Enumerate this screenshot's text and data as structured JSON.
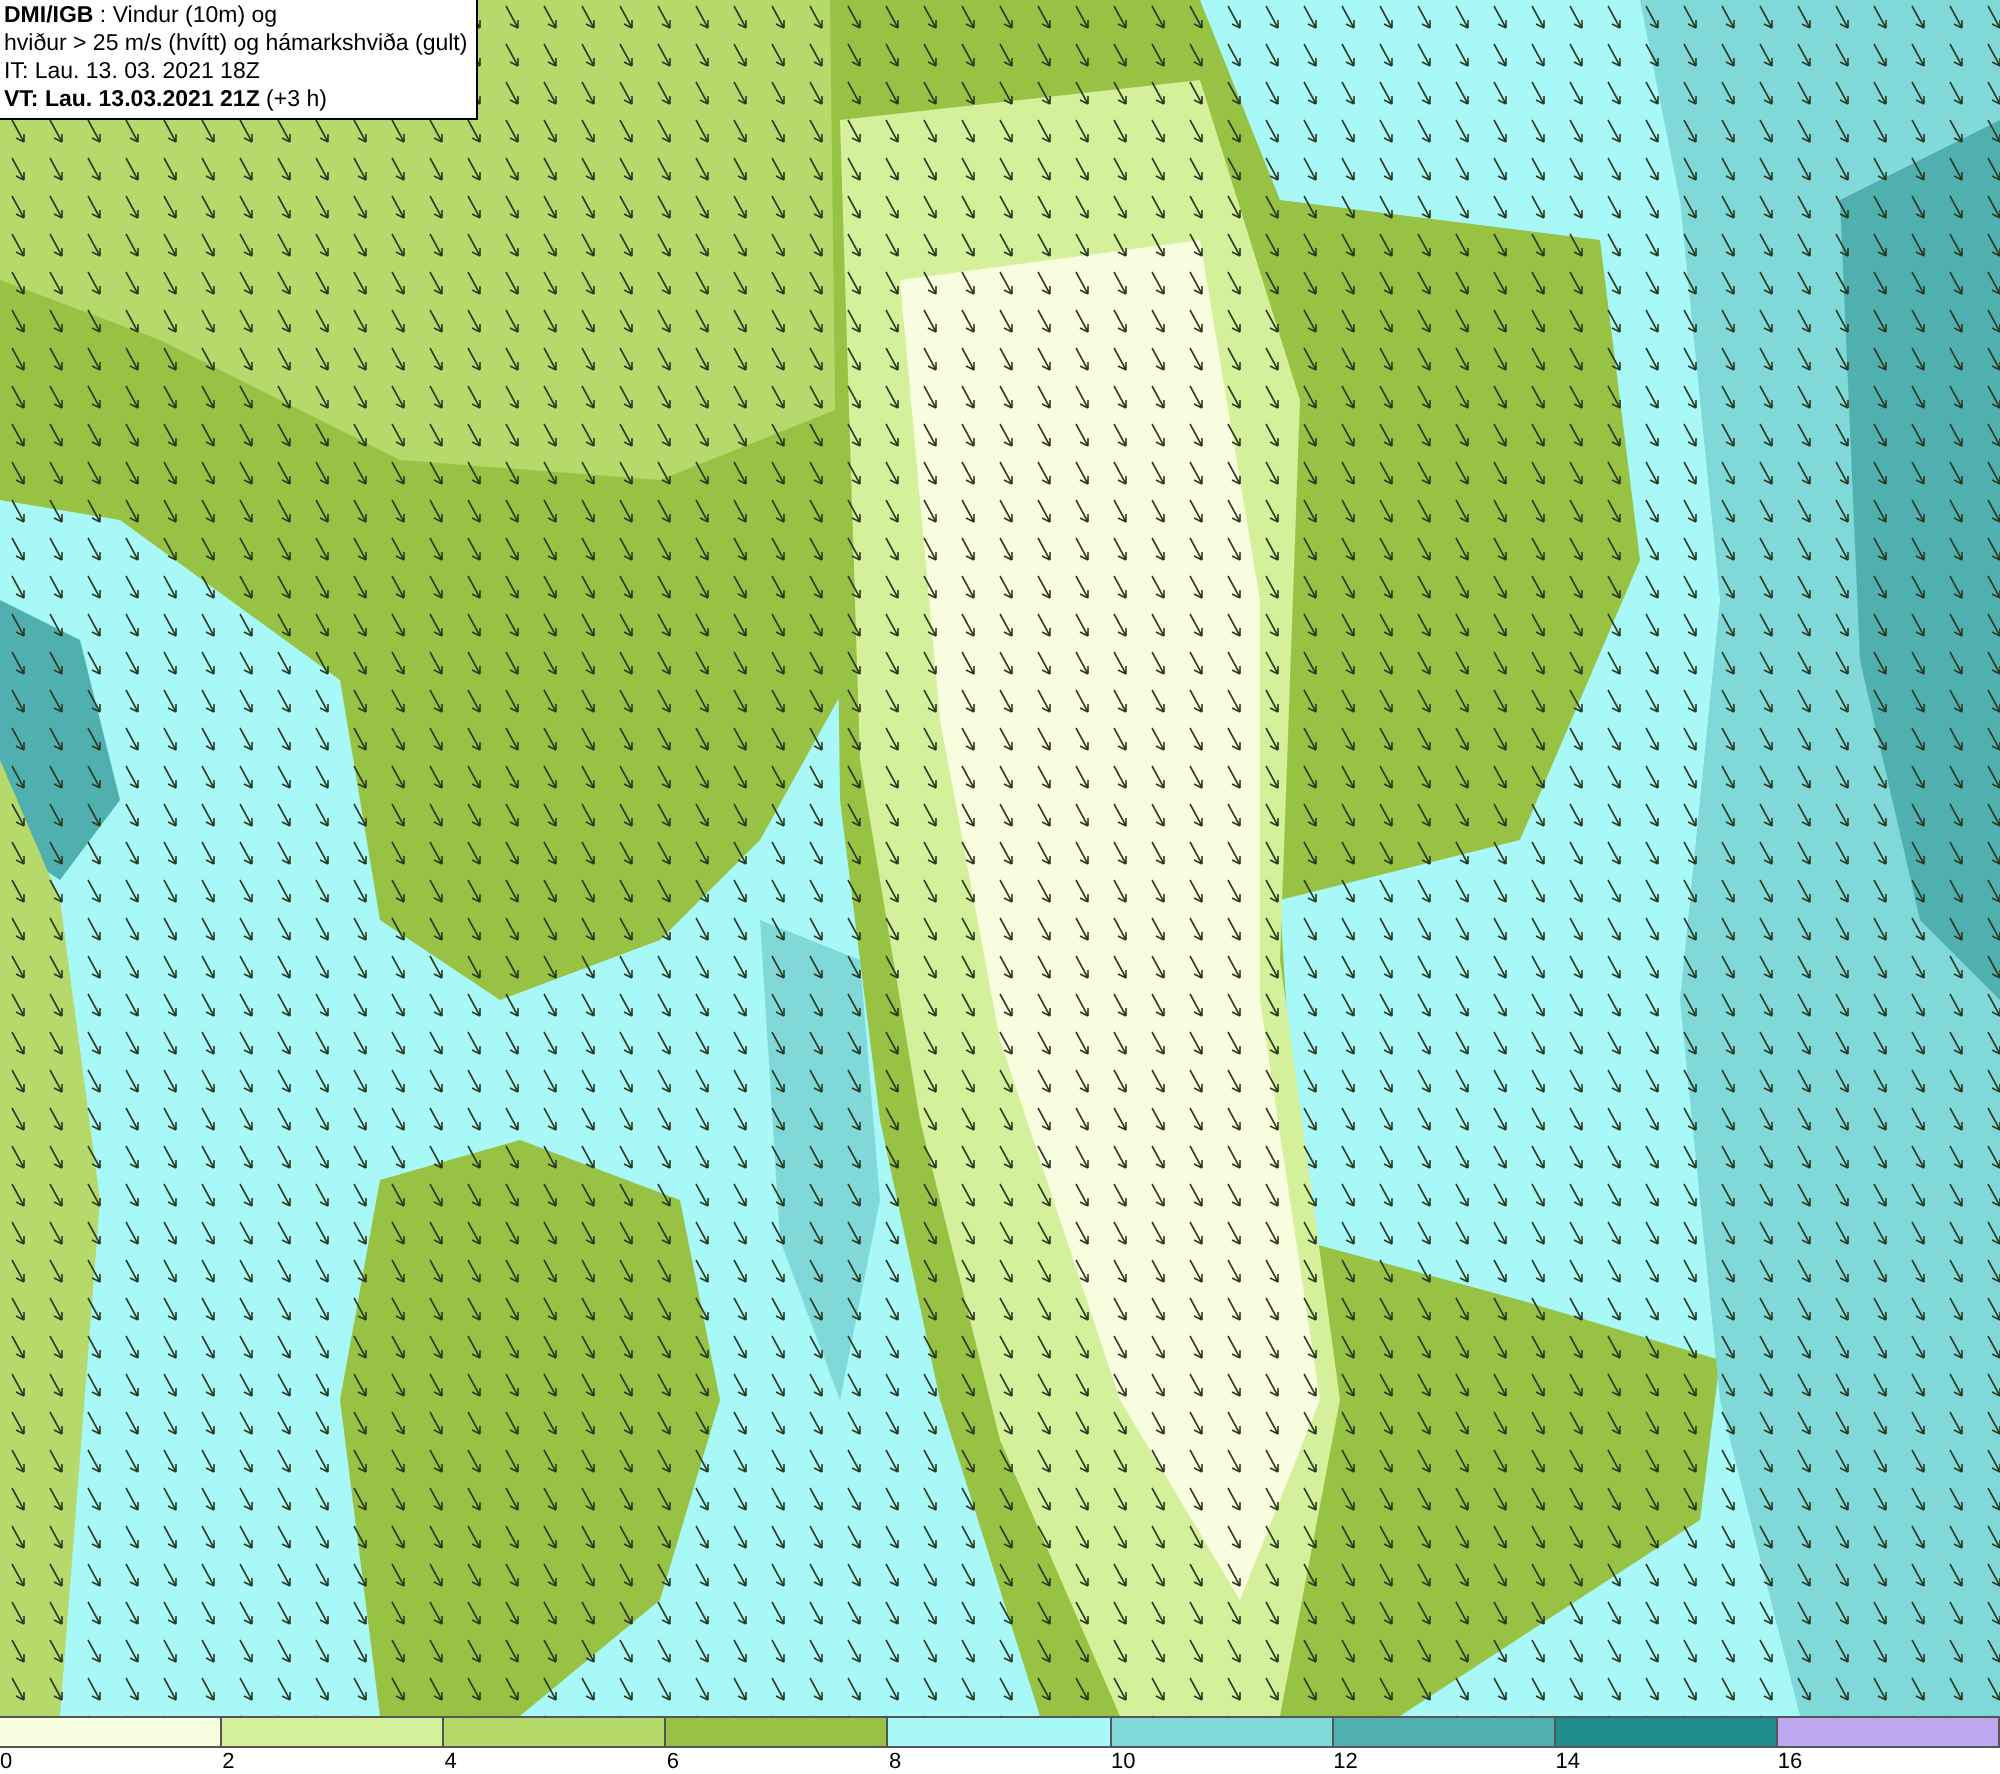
{
  "info": {
    "lines": [
      "**DMI/IGB** : Vindur (10m) og",
      "hviður > 25 m/s (hvítt) og hámarkshviða (gult)",
      "IT: Lau. 13. 03. 2021 18Z",
      "**VT: Lau. 13.03.2021 21Z** (+3 h)"
    ]
  },
  "legend": [
    {
      "label": "0",
      "color": "#f8fde0"
    },
    {
      "label": "2",
      "color": "#d4f09a"
    },
    {
      "label": "4",
      "color": "#b5d96a"
    },
    {
      "label": "6",
      "color": "#97c244"
    },
    {
      "label": "8",
      "color": "#a8f8f8"
    },
    {
      "label": "10",
      "color": "#80d8d8"
    },
    {
      "label": "12",
      "color": "#50b0b0"
    },
    {
      "label": "14",
      "color": "#208c8c"
    },
    {
      "label": "16",
      "color": "#c0a8f0"
    }
  ]
}
